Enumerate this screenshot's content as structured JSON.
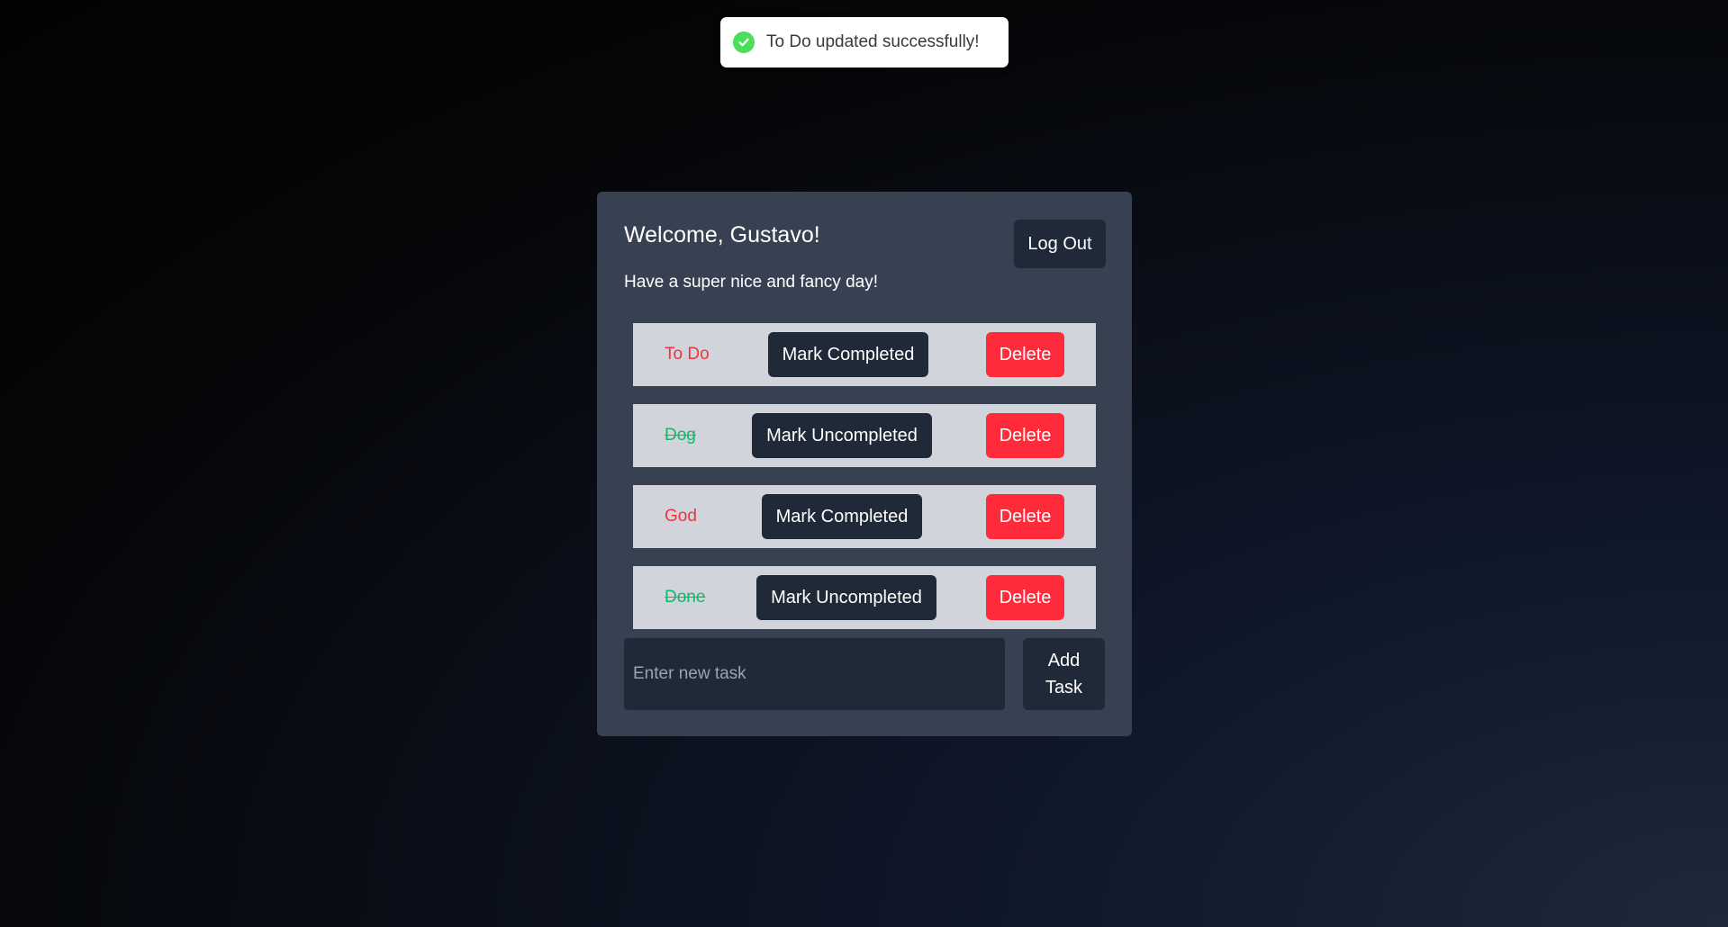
{
  "toast": {
    "icon": "check-circle-icon",
    "message": "To Do updated successfully!",
    "icon_color": "#4ade5a"
  },
  "header": {
    "welcome": "Welcome, Gustavo!",
    "subtitle": "Have a super nice and fancy day!",
    "logout_label": "Log Out"
  },
  "tasks": [
    {
      "title": "To Do",
      "completed": false,
      "toggle_label": "Mark Completed",
      "delete_label": "Delete"
    },
    {
      "title": "Dog",
      "completed": true,
      "toggle_label": "Mark Uncompleted",
      "delete_label": "Delete"
    },
    {
      "title": "God",
      "completed": false,
      "toggle_label": "Mark Completed",
      "delete_label": "Delete"
    },
    {
      "title": "Done",
      "completed": true,
      "toggle_label": "Mark Uncompleted",
      "delete_label": "Delete"
    }
  ],
  "new_task": {
    "placeholder": "Enter new task",
    "value": "",
    "add_label": "Add Task"
  },
  "colors": {
    "pending_text": "#ef3340",
    "completed_text": "#10b964",
    "delete_button": "#ff2a3a",
    "dark_button": "#1f2937",
    "card": "#374151",
    "row": "#d1d5db"
  }
}
